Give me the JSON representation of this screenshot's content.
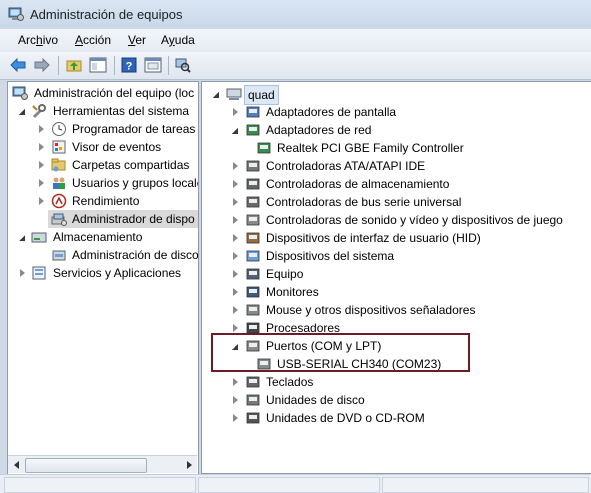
{
  "window": {
    "title": "Administración de equipos"
  },
  "menu": [
    {
      "label": "Archivo",
      "underline": "h"
    },
    {
      "label": "Acción",
      "underline": "A"
    },
    {
      "label": "Ver",
      "underline": "V"
    },
    {
      "label": "Ayuda",
      "underline": "y"
    }
  ],
  "toolbar": {
    "icons": [
      "back-arrow-icon",
      "forward-arrow-icon",
      "up-folder-icon",
      "show-hide-tree-icon",
      "help-icon",
      "properties-icon",
      "scan-hardware-icon"
    ]
  },
  "left_tree": {
    "root": "Administración del equipo (loc",
    "items": [
      {
        "label": "Herramientas del sistema",
        "icon": "tools-icon"
      },
      {
        "label": "Programador de tareas",
        "icon": "clock-icon"
      },
      {
        "label": "Visor de eventos",
        "icon": "event-viewer-icon"
      },
      {
        "label": "Carpetas compartidas",
        "icon": "shared-folder-icon"
      },
      {
        "label": "Usuarios y grupos locale",
        "icon": "users-icon"
      },
      {
        "label": "Rendimiento",
        "icon": "performance-icon"
      },
      {
        "label": "Administrador de dispo",
        "icon": "device-manager-icon"
      },
      {
        "label": "Almacenamiento",
        "icon": "storage-icon"
      },
      {
        "label": "Administración de disco",
        "icon": "disk-management-icon"
      },
      {
        "label": "Servicios y Aplicaciones",
        "icon": "services-icon"
      }
    ]
  },
  "right_tree": {
    "root": "quad",
    "items": [
      {
        "label": "Adaptadores de pantalla",
        "icon": "display-adapter-icon"
      },
      {
        "label": "Adaptadores de red",
        "icon": "network-adapter-icon"
      },
      {
        "label": "Realtek PCI GBE Family Controller",
        "icon": "network-card-icon"
      },
      {
        "label": "Controladoras ATA/ATAPI IDE",
        "icon": "ide-controller-icon"
      },
      {
        "label": "Controladoras de almacenamiento",
        "icon": "storage-controller-icon"
      },
      {
        "label": "Controladoras de bus serie universal",
        "icon": "usb-icon"
      },
      {
        "label": "Controladoras de sonido y vídeo y dispositivos de juego",
        "icon": "sound-icon"
      },
      {
        "label": "Dispositivos de interfaz de usuario (HID)",
        "icon": "hid-icon"
      },
      {
        "label": "Dispositivos del sistema",
        "icon": "system-device-icon"
      },
      {
        "label": "Equipo",
        "icon": "computer-icon"
      },
      {
        "label": "Monitores",
        "icon": "monitor-icon"
      },
      {
        "label": "Mouse y otros dispositivos señaladores",
        "icon": "mouse-icon"
      },
      {
        "label": "Procesadores",
        "icon": "processor-icon"
      },
      {
        "label": "Puertos (COM y LPT)",
        "icon": "port-icon"
      },
      {
        "label": "USB-SERIAL CH340 (COM23)",
        "icon": "serial-port-icon"
      },
      {
        "label": "Teclados",
        "icon": "keyboard-icon"
      },
      {
        "label": "Unidades de disco",
        "icon": "disk-drive-icon"
      },
      {
        "label": "Unidades de DVD o CD-ROM",
        "icon": "dvd-icon"
      }
    ]
  },
  "colors": {
    "highlight_border": "#6e1a28",
    "selection": "#d9d9d9"
  }
}
